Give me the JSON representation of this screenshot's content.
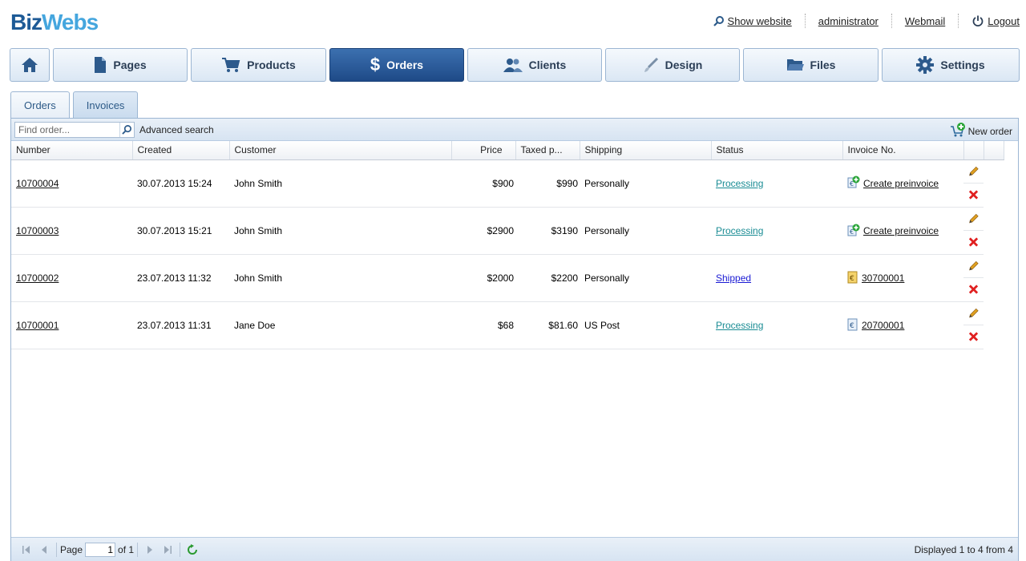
{
  "brand": {
    "part1": "Biz",
    "part2": "Webs"
  },
  "top_links": {
    "show_website": "Show website",
    "user": "administrator",
    "webmail": "Webmail",
    "logout": "Logout"
  },
  "nav": {
    "pages": "Pages",
    "products": "Products",
    "orders": "Orders",
    "clients": "Clients",
    "design": "Design",
    "files": "Files",
    "settings": "Settings"
  },
  "subtabs": {
    "orders": "Orders",
    "invoices": "Invoices"
  },
  "toolbar": {
    "search_placeholder": "Find order...",
    "advanced_search": "Advanced search",
    "new_order": "New order"
  },
  "columns": {
    "number": "Number",
    "created": "Created",
    "customer": "Customer",
    "price": "Price",
    "taxed": "Taxed p...",
    "shipping": "Shipping",
    "status": "Status",
    "invoice": "Invoice No."
  },
  "rows": [
    {
      "number": "10700004",
      "created": "30.07.2013 15:24",
      "customer": "John Smith",
      "price": "$900",
      "taxed": "$990",
      "shipping": "Personally",
      "status": "Processing",
      "invoice": "Create preinvoice"
    },
    {
      "number": "10700003",
      "created": "30.07.2013 15:21",
      "customer": "John Smith",
      "price": "$2900",
      "taxed": "$3190",
      "shipping": "Personally",
      "status": "Processing",
      "invoice": "Create preinvoice"
    },
    {
      "number": "10700002",
      "created": "23.07.2013 11:32",
      "customer": "John Smith",
      "price": "$2000",
      "taxed": "$2200",
      "shipping": "Personally",
      "status": "Shipped",
      "invoice": "30700001"
    },
    {
      "number": "10700001",
      "created": "23.07.2013 11:31",
      "customer": "Jane Doe",
      "price": "$68",
      "taxed": "$81.60",
      "shipping": "US Post",
      "status": "Processing",
      "invoice": "20700001"
    }
  ],
  "pager": {
    "page_label": "Page",
    "page_value": "1",
    "of_label": "of 1",
    "info": "Displayed 1 to 4 from 4"
  },
  "colors": {
    "accent": "#1e4a87",
    "status_link": "#1a8c94",
    "shipped_link": "#1b1bd4",
    "delete": "#e02020"
  }
}
